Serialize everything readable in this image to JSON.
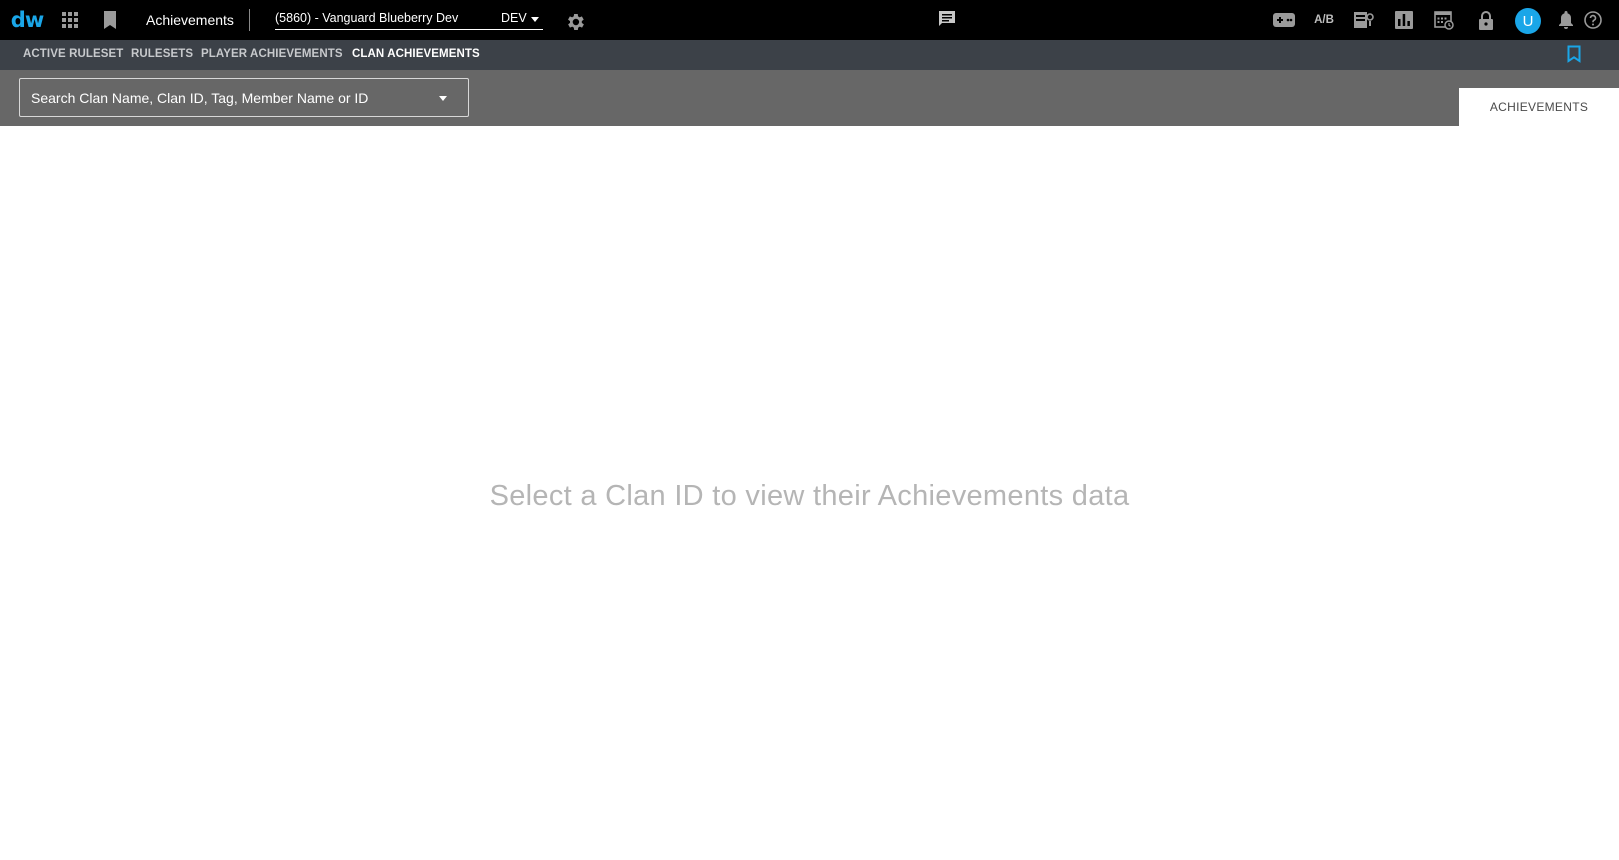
{
  "header": {
    "logo_text": "dw",
    "app_title": "Achievements",
    "game_selector": {
      "name": "(5860) - Vanguard Blueberry Dev",
      "env": "DEV"
    },
    "ab_label": "A/B",
    "avatar_initial": "U",
    "accent_color": "#1aa6e8",
    "icons": [
      "apps-grid-icon",
      "bookmark-icon",
      "gear-icon",
      "chat-icon",
      "gamepad-icon",
      "ab-test-icon",
      "badge-icon",
      "bar-chart-icon",
      "calendar-clock-icon",
      "lock-icon",
      "bell-icon",
      "help-icon"
    ]
  },
  "nav": {
    "tabs": [
      {
        "label": "ACTIVE RULESET",
        "active": false
      },
      {
        "label": "RULESETS",
        "active": false
      },
      {
        "label": "PLAYER ACHIEVEMENTS",
        "active": false
      },
      {
        "label": "CLAN ACHIEVEMENTS",
        "active": true
      }
    ]
  },
  "filter": {
    "search_placeholder": "Search Clan Name, Clan ID, Tag, Member Name or ID",
    "tab_label": "ACHIEVEMENTS"
  },
  "main": {
    "empty_message": "Select a Clan ID to view their Achievements data"
  }
}
